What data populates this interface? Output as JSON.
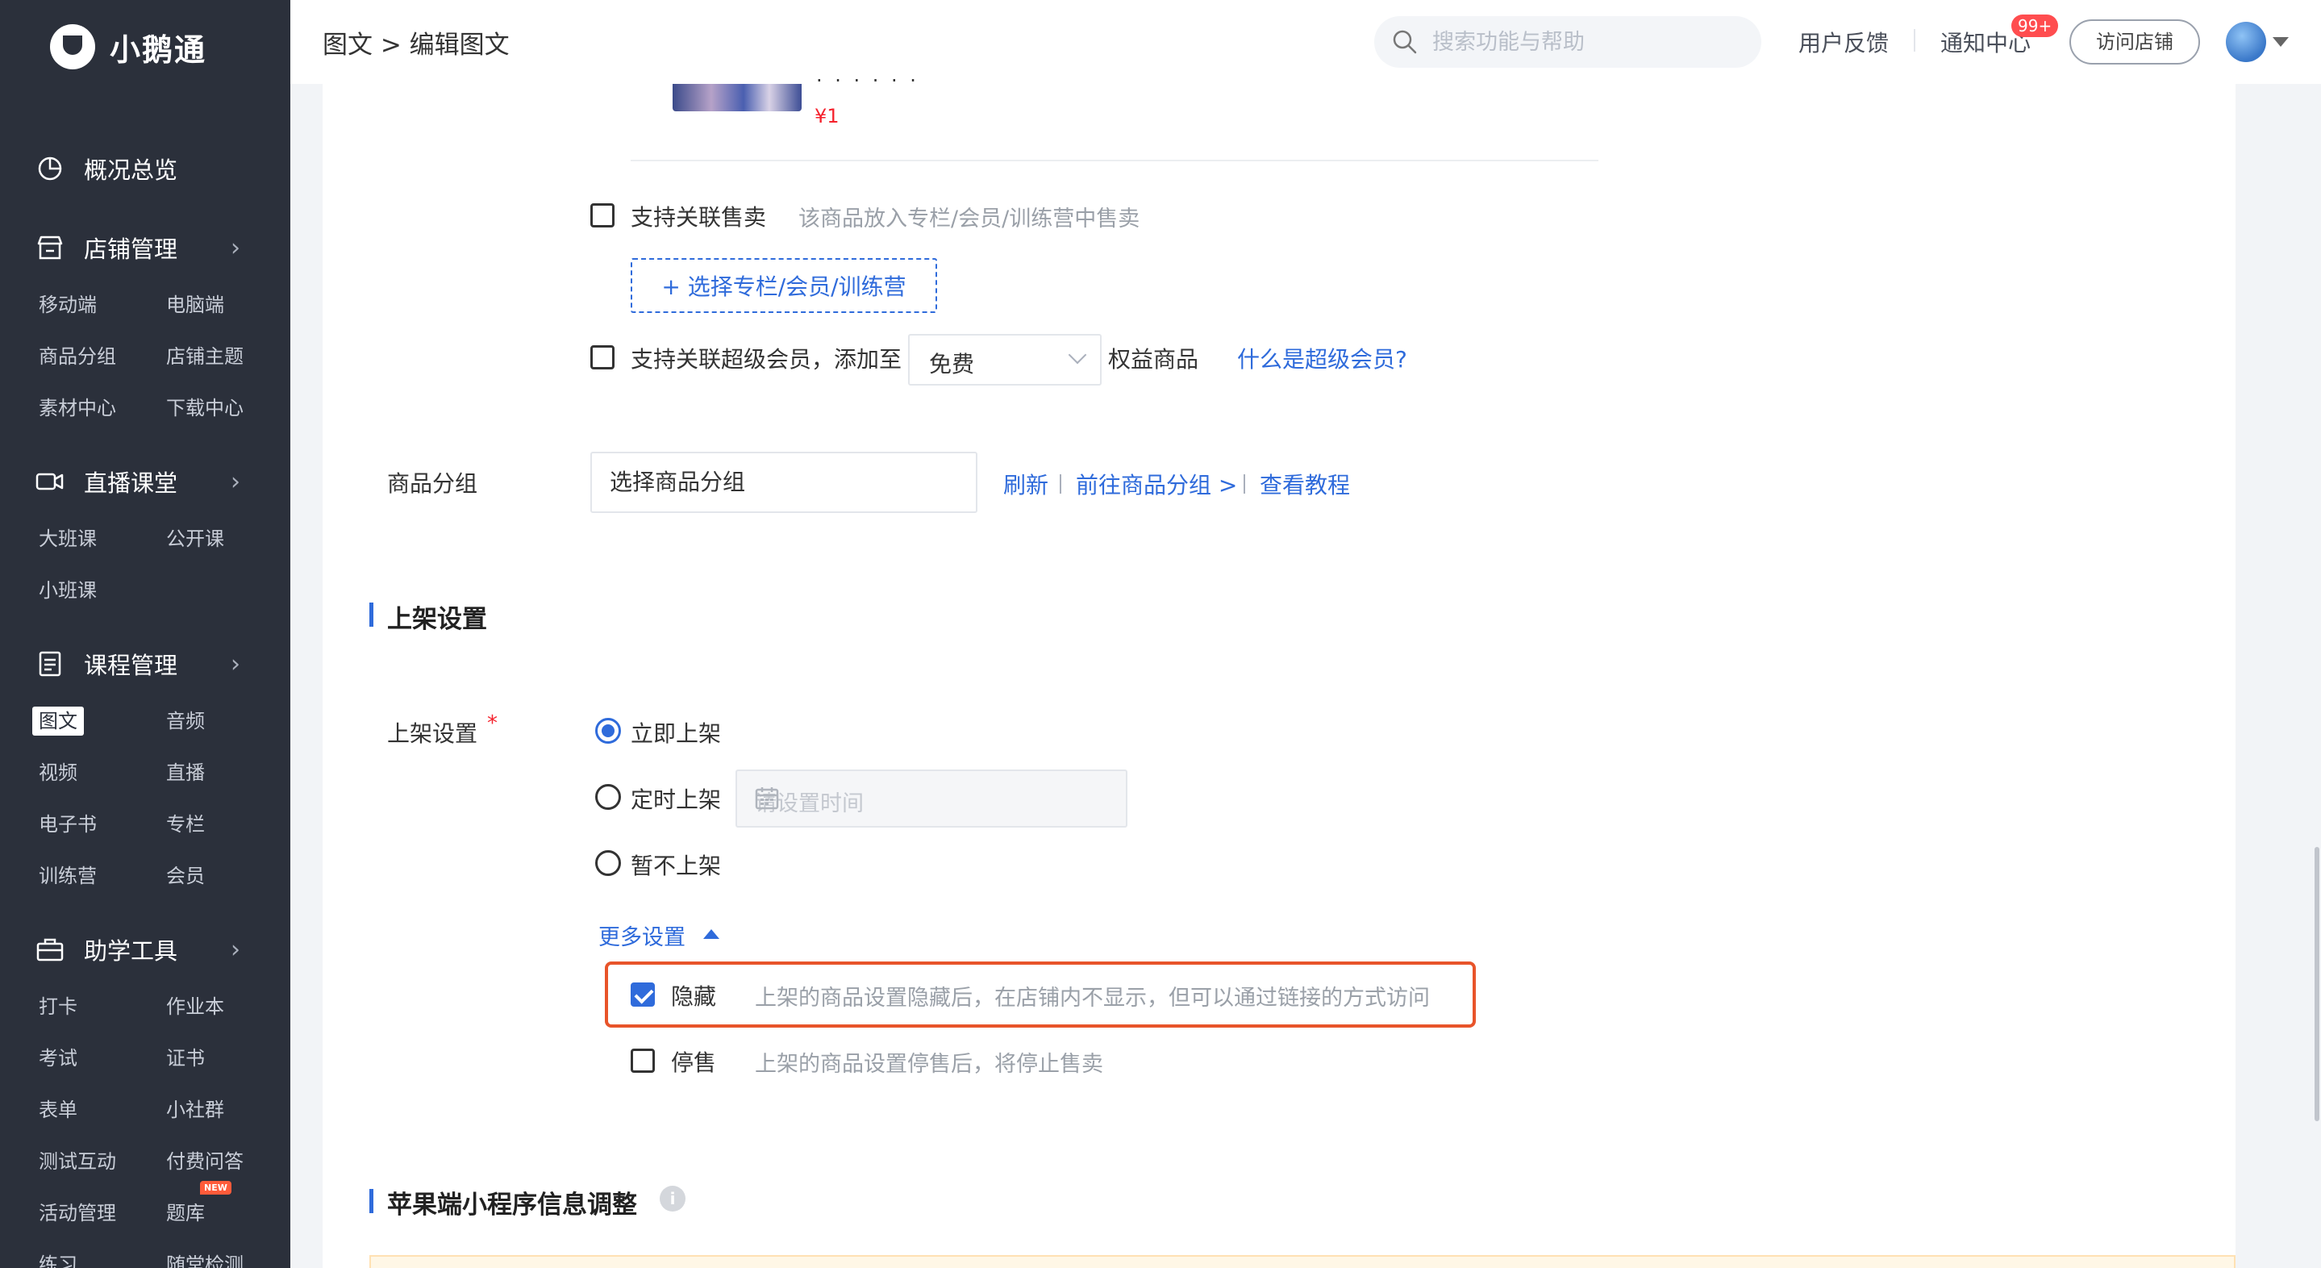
{
  "app": {
    "name": "小鹅通"
  },
  "sidebar": {
    "overview": "概况总览",
    "groups": [
      {
        "label": "店铺管理",
        "items": [
          "移动端",
          "电脑端",
          "商品分组",
          "店铺主题",
          "素材中心",
          "下载中心"
        ]
      },
      {
        "label": "直播课堂",
        "items": [
          "大班课",
          "公开课",
          "小班课"
        ]
      },
      {
        "label": "课程管理",
        "items": [
          "图文",
          "音频",
          "视频",
          "直播",
          "电子书",
          "专栏",
          "训练营",
          "会员"
        ]
      },
      {
        "label": "助学工具",
        "items": [
          "打卡",
          "作业本",
          "考试",
          "证书",
          "表单",
          "小社群",
          "测试互动",
          "付费问答",
          "活动管理",
          "题库",
          "练习",
          "随堂检测"
        ]
      }
    ],
    "active_item": "图文",
    "new_badge": "NEW"
  },
  "header": {
    "breadcrumb": "图文 > 编辑图文",
    "search_placeholder": "搜索功能与帮助",
    "feedback": "用户反馈",
    "notifications": "通知中心",
    "notification_count": "99+",
    "visit_store": "访问店铺"
  },
  "product": {
    "dots": "· · · · · ·",
    "price": "¥1"
  },
  "association": {
    "checkbox_label": "支持关联售卖",
    "hint": "该商品放入专栏/会员/训练营中售卖",
    "select_button": "+ 选择专栏/会员/训练营",
    "svip_label": "支持关联超级会员，添加至",
    "svip_select_value": "免费",
    "svip_suffix": "权益商品",
    "svip_link": "什么是超级会员?"
  },
  "group": {
    "label": "商品分组",
    "input_value": "选择商品分组",
    "refresh": "刷新",
    "goto": "前往商品分组 >",
    "tutorial": "查看教程"
  },
  "listing": {
    "section_title": "上架设置",
    "field_label": "上架设置",
    "required_mark": "*",
    "options": [
      "立即上架",
      "定时上架",
      "暂不上架"
    ],
    "selected": "立即上架",
    "date_placeholder": "请设置时间",
    "more_settings": "更多设置",
    "hide_label": "隐藏",
    "hide_hint": "上架的商品设置隐藏后，在店铺内不显示，但可以通过链接的方式访问",
    "hide_checked": true,
    "stop_label": "停售",
    "stop_hint": "上架的商品设置停售后，将停止售卖",
    "stop_checked": false
  },
  "apple_section": {
    "title": "苹果端小程序信息调整",
    "info_icon": "i"
  },
  "colors": {
    "accent": "#2f6bdb",
    "highlight": "#e8542a",
    "sidebar_bg": "#2b303b",
    "price": "#f5222d"
  }
}
